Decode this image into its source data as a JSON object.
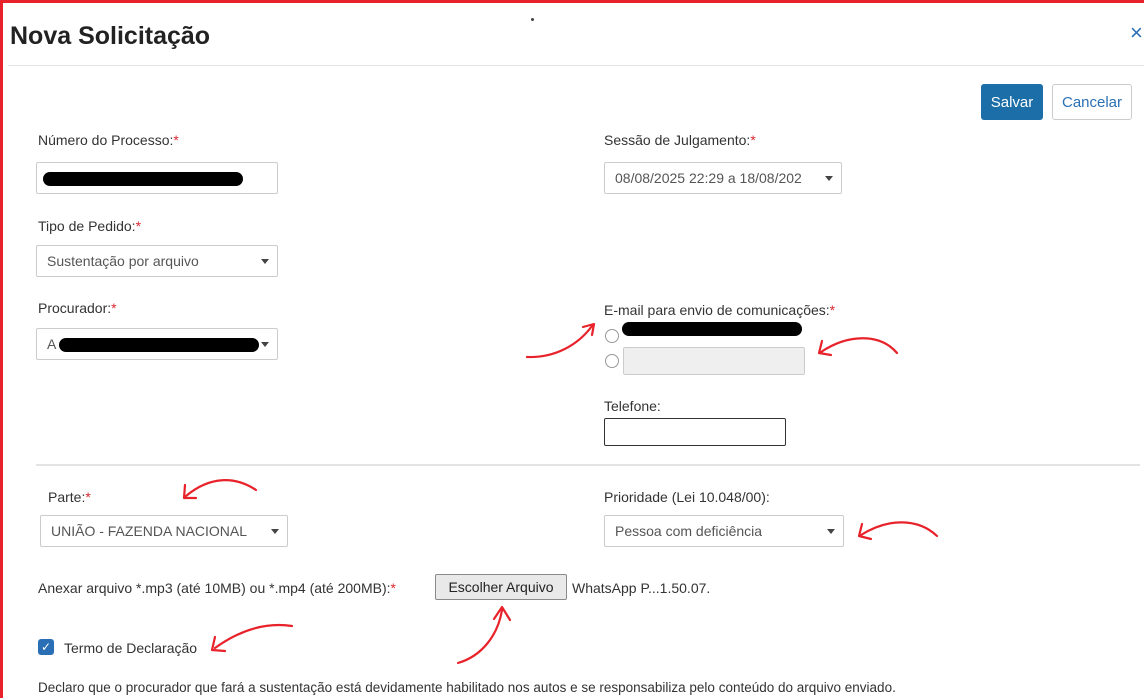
{
  "dialog": {
    "title": "Nova Solicitação",
    "close_icon": "×"
  },
  "toolbar": {
    "save_label": "Salvar",
    "cancel_label": "Cancelar"
  },
  "form": {
    "processo": {
      "label": "Número do Processo:",
      "required": "*"
    },
    "sessao": {
      "label": "Sessão de Julgamento:",
      "required": "*",
      "value": "08/08/2025 22:29 a 18/08/202"
    },
    "tipo_pedido": {
      "label": "Tipo de Pedido:",
      "required": "*",
      "value": "Sustentação por arquivo"
    },
    "procurador": {
      "label": "Procurador:",
      "required": "*",
      "value_prefix": "A"
    },
    "email": {
      "label": "E-mail para envio de comunicações:",
      "required": "*"
    },
    "telefone": {
      "label": "Telefone:"
    },
    "parte": {
      "label": "Parte:",
      "required": "*",
      "value": "UNIÃO - FAZENDA NACIONAL"
    },
    "prioridade": {
      "label": "Prioridade (Lei 10.048/00):",
      "value": "Pessoa com deficiência"
    },
    "anexo": {
      "label": "Anexar arquivo *.mp3 (até 10MB) ou *.mp4 (até 200MB):",
      "required": "*",
      "button_label": "Escolher Arquivo",
      "file_name": "WhatsApp P...1.50.07."
    },
    "termo": {
      "label": "Termo de Declaração",
      "checked": true
    },
    "declaracao": "Declaro que o procurador que fará a sustentação está devidamente habilitado nos autos e se responsabiliza pelo conteúdo do arquivo enviado."
  },
  "colors": {
    "accent": "#1b6ea8",
    "required": "#d9282f",
    "annotation": "#e8222a"
  },
  "icons": {
    "close": "close-icon",
    "check": "check-icon",
    "caret": "chevron-down-icon"
  }
}
